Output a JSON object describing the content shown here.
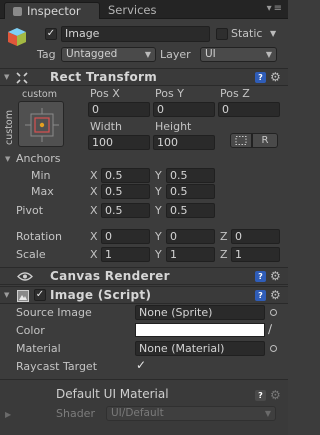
{
  "tabs": [
    {
      "label": "Inspector",
      "active": true
    },
    {
      "label": "Services",
      "active": false
    }
  ],
  "object": {
    "name": "Image",
    "static_label": "Static",
    "tag_label": "Tag",
    "tag_value": "Untagged",
    "layer_label": "Layer",
    "layer_value": "UI"
  },
  "rect_transform": {
    "title": "Rect Transform",
    "anchor_top_label": "custom",
    "anchor_side_label": "custom",
    "headers": [
      "Pos X",
      "Pos Y",
      "Pos Z"
    ],
    "pos": [
      "0",
      "0",
      "0"
    ],
    "size_headers": [
      "Width",
      "Height"
    ],
    "size": [
      "100",
      "100"
    ],
    "r_button": "R",
    "anchors_label": "Anchors",
    "min_label": "Min",
    "min": {
      "x": "0.5",
      "y": "0.5"
    },
    "max_label": "Max",
    "max": {
      "x": "0.5",
      "y": "0.5"
    },
    "pivot_label": "Pivot",
    "pivot": {
      "x": "0.5",
      "y": "0.5"
    },
    "rotation_label": "Rotation",
    "rotation": {
      "x": "0",
      "y": "0",
      "z": "0"
    },
    "scale_label": "Scale",
    "scale": {
      "x": "1",
      "y": "1",
      "z": "1"
    },
    "axis_x": "X",
    "axis_y": "Y",
    "axis_z": "Z"
  },
  "canvas_renderer": {
    "title": "Canvas Renderer"
  },
  "image_script": {
    "title": "Image (Script)",
    "source_image_label": "Source Image",
    "source_image_value": "None (Sprite)",
    "color_label": "Color",
    "color_value": "#ffffff",
    "material_label": "Material",
    "material_value": "None (Material)",
    "raycast_label": "Raycast Target"
  },
  "material": {
    "title": "Default UI Material",
    "shader_label": "Shader",
    "shader_value": "UI/Default"
  },
  "colors": {
    "accent": "#2f5db8",
    "background": "#3c3c3c"
  }
}
